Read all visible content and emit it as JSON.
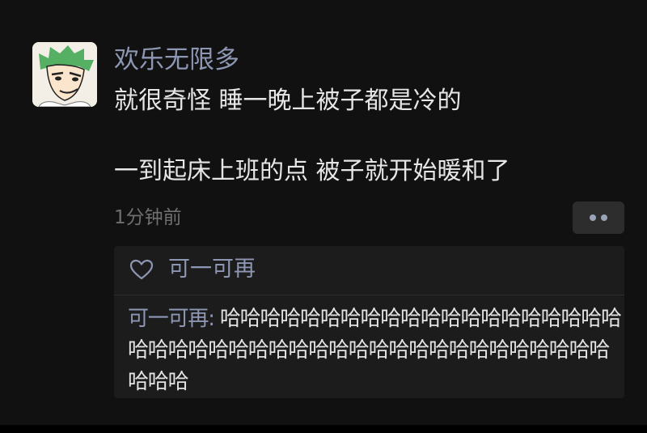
{
  "post": {
    "username": "欢乐无限多",
    "content_lines": [
      "就很奇怪 睡一晚上被子都是冷的",
      "一到起床上班的点 被子就开始暖和了"
    ],
    "timestamp": "1分钟前",
    "avatar_icon": "cartoon-avatar-icon",
    "more_icon": "more-dots-icon"
  },
  "likes": {
    "icon": "heart-icon",
    "names": "可一可再"
  },
  "comments": [
    {
      "author": "可一可再:",
      "text": "哈哈哈哈哈哈哈哈哈哈哈哈哈哈哈哈哈哈哈哈哈哈哈哈哈哈哈哈哈哈哈哈哈哈哈哈哈哈哈哈哈哈哈哈哈哈哈"
    }
  ],
  "colors": {
    "background": "#111111",
    "name_accent": "#8d97b4",
    "text": "#e6e6e6",
    "muted": "#6f6f6f",
    "panel": "#1c1c1c"
  }
}
